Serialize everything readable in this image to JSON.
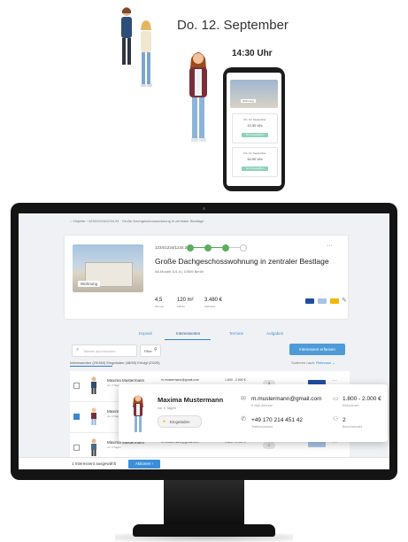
{
  "illustration": {
    "date": "Do. 12. September",
    "time": "14:30 Uhr",
    "phone": {
      "slot1_label": "Do. 12. September",
      "slot1_time": "13:30 Uhr",
      "slot1_button": "Termin auswählen",
      "slot2_label": "Do. 12. September",
      "slot2_time": "14:00 Uhr",
      "slot2_button": "Termin auswählen",
      "photo_tag": "Wohnung"
    }
  },
  "app": {
    "breadcrumb": "Objekte › 1234/1234/1234.24 · Große Dachgeschosswohnung in zentraler Bestlage",
    "property": {
      "photo_tag": "Wohnung",
      "id": "1234/1234/1234.24",
      "title": "Große Dachgeschosswohnung in zentraler Bestlage",
      "address": "Alt-Moabit 101 A | 10559 Berlin",
      "rooms_value": "4,5",
      "rooms_label": "Zimmer",
      "area_value": "120 m²",
      "area_label": "Fläche",
      "price_value": "3.480 €",
      "price_label": "Kaltmiete",
      "more": "···",
      "progress": 0.67,
      "colors": {
        "progress": "#5cae61",
        "logo1": "#1f4ea1",
        "logo2": "#a8c3e6",
        "logo3": "#f2b705"
      }
    },
    "tabs": [
      "Exposé",
      "Interessenten",
      "Termine",
      "Aufgaben"
    ],
    "search_placeholder": "Tabelle durchsuchen",
    "filter_label": "Filter",
    "primary_button": "Interessent erfassen",
    "subtabs": "Interessenten (29/360)    Eingeladen (48/55)    Erfolgt (23/25)",
    "sorting_label": "Sortieren nach:",
    "sorting_value": "Relevanz",
    "rows": [
      {
        "name": "Maxima Mustermann",
        "sub": "vor 3 Tagen",
        "mail": "m.mustermann@gmail.com",
        "amount": "1.800 - 2.000 €",
        "count": "3",
        "more": "···"
      },
      {
        "name": "Maxima Mustermann",
        "sub": "vor 3 Tagen",
        "mail": "m.mustermann@gmail.com",
        "amount": "1.800 - 2.000 €",
        "count": "2",
        "more": "···"
      },
      {
        "name": "Maxima Mustermann",
        "sub": "vor 3 Tagen",
        "mail": "m.mustermann@gmail.com",
        "amount": "1.800 - 2.000 €",
        "count": "1",
        "more": "···"
      }
    ],
    "popup": {
      "name": "Maxima Mustermann",
      "since": "vor 3 Tagen",
      "status": "Eingeladen",
      "email": "m.mustermann@gmail.com",
      "email_label": "E-Mail-Adresse",
      "phone": "+49 170 214 451 42",
      "phone_label": "Telefonnummer",
      "income": "1.800 - 2.000 €",
      "income_label": "Einkommen",
      "persons": "2",
      "persons_label": "Bewohnerzahl"
    },
    "bottom": {
      "selected_text": "1 Interessent ausgewählt",
      "button": "Aktionen"
    }
  }
}
